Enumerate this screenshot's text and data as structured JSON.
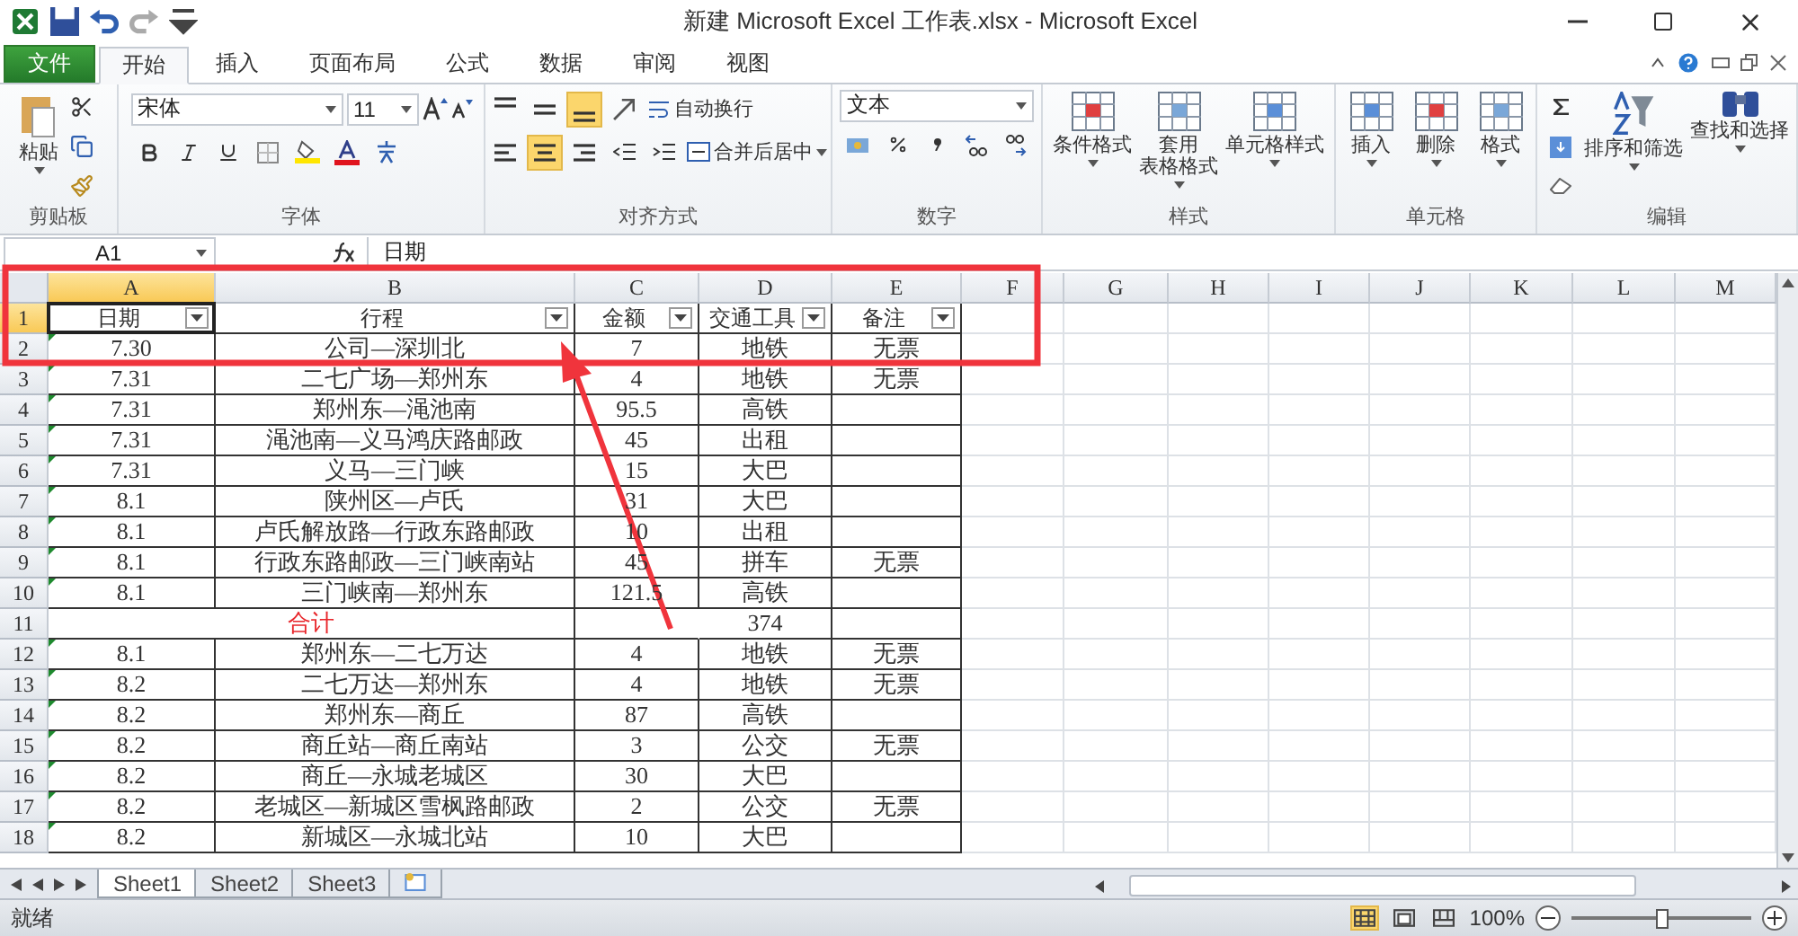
{
  "window": {
    "title": "新建 Microsoft Excel 工作表.xlsx - Microsoft Excel"
  },
  "ribbon_tabs": [
    {
      "label": "文件",
      "kind": "file",
      "selected": false
    },
    {
      "label": "开始",
      "kind": "tab",
      "selected": true
    },
    {
      "label": "插入",
      "kind": "tab",
      "selected": false
    },
    {
      "label": "页面布局",
      "kind": "tab",
      "selected": false
    },
    {
      "label": "公式",
      "kind": "tab",
      "selected": false
    },
    {
      "label": "数据",
      "kind": "tab",
      "selected": false
    },
    {
      "label": "审阅",
      "kind": "tab",
      "selected": false
    },
    {
      "label": "视图",
      "kind": "tab",
      "selected": false
    }
  ],
  "ribbon": {
    "clipboard": {
      "label": "剪贴板",
      "paste": "粘贴"
    },
    "font": {
      "label": "字体",
      "font_name": "宋体",
      "font_size": "11"
    },
    "alignment": {
      "label": "对齐方式",
      "wrap": "自动换行",
      "merge": "合并后居中",
      "vertical": [
        {
          "kind": "top",
          "selected": false
        },
        {
          "kind": "middle",
          "selected": false
        },
        {
          "kind": "bottom",
          "selected": true
        }
      ],
      "horizontal": [
        {
          "kind": "left",
          "selected": false
        },
        {
          "kind": "center",
          "selected": true
        },
        {
          "kind": "right",
          "selected": false
        }
      ]
    },
    "number": {
      "label": "数字",
      "format": "文本"
    },
    "styles": {
      "label": "样式",
      "buttons": [
        {
          "lines": [
            "条件格式"
          ]
        },
        {
          "lines": [
            "套用",
            "表格格式"
          ]
        },
        {
          "lines": [
            "单元格样式"
          ]
        }
      ]
    },
    "cells": {
      "label": "单元格",
      "buttons": [
        "插入",
        "删除",
        "格式"
      ]
    },
    "editing": {
      "label": "编辑",
      "buttons": [
        "排序和筛选",
        "查找和选择"
      ]
    }
  },
  "formula_bar": {
    "name_box": "A1",
    "content": "日期"
  },
  "columns": [
    {
      "label": "A",
      "selected": true
    },
    {
      "label": "B",
      "selected": false
    },
    {
      "label": "C",
      "selected": false
    },
    {
      "label": "D",
      "selected": false
    },
    {
      "label": "E",
      "selected": false
    },
    {
      "label": "F",
      "selected": false
    },
    {
      "label": "G",
      "selected": false
    },
    {
      "label": "H",
      "selected": false
    },
    {
      "label": "I",
      "selected": false
    },
    {
      "label": "J",
      "selected": false
    },
    {
      "label": "K",
      "selected": false
    },
    {
      "label": "L",
      "selected": false
    },
    {
      "label": "M",
      "selected": false
    }
  ],
  "rows": [
    {
      "number": "1",
      "kind": "header",
      "selected": true,
      "cells": [
        "日期",
        "行程",
        "金额",
        "交通工具",
        "备注"
      ]
    },
    {
      "number": "2",
      "kind": "data",
      "selected": false,
      "cells": [
        "7.30",
        "公司—深圳北",
        "7",
        "地铁",
        "无票"
      ]
    },
    {
      "number": "3",
      "kind": "data",
      "selected": false,
      "cells": [
        "7.31",
        "二七广场—郑州东",
        "4",
        "地铁",
        "无票"
      ]
    },
    {
      "number": "4",
      "kind": "data",
      "selected": false,
      "cells": [
        "7.31",
        "郑州东—渑池南",
        "95.5",
        "高铁"
      ]
    },
    {
      "number": "5",
      "kind": "data",
      "selected": false,
      "cells": [
        "7.31",
        "渑池南—义马鸿庆路邮政",
        "45",
        "出租"
      ]
    },
    {
      "number": "6",
      "kind": "data",
      "selected": false,
      "cells": [
        "7.31",
        "义马—三门峡",
        "15",
        "大巴"
      ]
    },
    {
      "number": "7",
      "kind": "data",
      "selected": false,
      "cells": [
        "8.1",
        "陕州区—卢氏",
        "31",
        "大巴"
      ]
    },
    {
      "number": "8",
      "kind": "data",
      "selected": false,
      "cells": [
        "8.1",
        "卢氏解放路—行政东路邮政",
        "10",
        "出租"
      ]
    },
    {
      "number": "9",
      "kind": "data",
      "selected": false,
      "cells": [
        "8.1",
        "行政东路邮政—三门峡南站",
        "45",
        "拼车",
        "无票"
      ]
    },
    {
      "number": "10",
      "kind": "data",
      "selected": false,
      "cells": [
        "8.1",
        "三门峡南—郑州东",
        "121.5",
        "高铁"
      ]
    },
    {
      "number": "11",
      "kind": "total",
      "selected": false,
      "cells": [
        "合计",
        "374"
      ]
    },
    {
      "number": "12",
      "kind": "data",
      "selected": false,
      "cells": [
        "8.1",
        "郑州东—二七万达",
        "4",
        "地铁",
        "无票"
      ]
    },
    {
      "number": "13",
      "kind": "data",
      "selected": false,
      "cells": [
        "8.2",
        "二七万达—郑州东",
        "4",
        "地铁",
        "无票"
      ]
    },
    {
      "number": "14",
      "kind": "data",
      "selected": false,
      "cells": [
        "8.2",
        "郑州东—商丘",
        "87",
        "高铁"
      ]
    },
    {
      "number": "15",
      "kind": "data",
      "selected": false,
      "cells": [
        "8.2",
        "商丘站—商丘南站",
        "3",
        "公交",
        "无票"
      ]
    },
    {
      "number": "16",
      "kind": "data",
      "selected": false,
      "cells": [
        "8.2",
        "商丘—永城老城区",
        "30",
        "大巴"
      ]
    },
    {
      "number": "17",
      "kind": "data",
      "selected": false,
      "cells": [
        "8.2",
        "老城区—新城区雪枫路邮政",
        "2",
        "公交",
        "无票"
      ]
    },
    {
      "number": "18",
      "kind": "data",
      "selected": false,
      "cells": [
        "8.2",
        "新城区—永城北站",
        "10",
        "大巴"
      ]
    }
  ],
  "sheet_tabs": [
    {
      "label": "Sheet1",
      "selected": true
    },
    {
      "label": "Sheet2",
      "selected": false
    },
    {
      "label": "Sheet3",
      "selected": false
    }
  ],
  "status_bar": {
    "status": "就绪",
    "zoom": "100%",
    "views": [
      {
        "kind": "normal",
        "selected": true
      },
      {
        "kind": "layout",
        "selected": false
      },
      {
        "kind": "break",
        "selected": false
      }
    ],
    "level": 0.5
  }
}
